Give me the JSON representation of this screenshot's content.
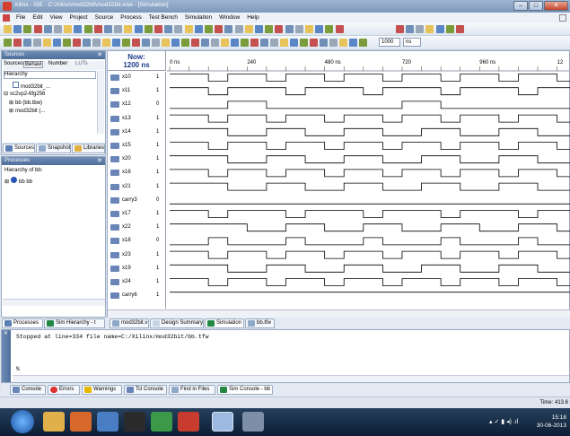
{
  "window": {
    "title": "Xilinx - ISE - C:\\Xilinx\\mod32bit\\mod32bit.xise - [Simulation]"
  },
  "menu": [
    "File",
    "Edit",
    "View",
    "Project",
    "Source",
    "Process",
    "Test Bench",
    "Simulation",
    "Window",
    "Help"
  ],
  "toolbar": {
    "run_time": "1000",
    "run_unit": "ns"
  },
  "sources_panel": {
    "header": "Sources",
    "filters": [
      "Sources",
      "Behavi",
      "Number",
      "LUTs"
    ],
    "hierarchy_label": "Hierarchy",
    "tree": [
      "mod32bit_...",
      "xc2vp2-6fg256",
      "bb (bb.tbw)",
      "mod32bit (..."
    ],
    "tabs": [
      "Sources",
      "Snapshot",
      "Libraries"
    ]
  },
  "processes_panel": {
    "header": "Processes",
    "hierarchy_label": "Hierarchy of bb:",
    "tree": [
      "bb bb"
    ],
    "tabs": [
      "Processes",
      "Sim Hierarchy - t"
    ]
  },
  "wave": {
    "cursor_label": "Now:",
    "cursor_value": "1200 ns",
    "time_ticks": [
      {
        "t": 0,
        "label": "0 ns"
      },
      {
        "t": 240,
        "label": "240"
      },
      {
        "t": 480,
        "label": "480 ns"
      },
      {
        "t": 720,
        "label": "720"
      },
      {
        "t": 960,
        "label": "960 ns"
      },
      {
        "t": 1200,
        "label": "12"
      }
    ],
    "signals": [
      {
        "name": "x10",
        "value": "1"
      },
      {
        "name": "x11",
        "value": "1"
      },
      {
        "name": "x12",
        "value": "0"
      },
      {
        "name": "x13",
        "value": "1"
      },
      {
        "name": "x14",
        "value": "1"
      },
      {
        "name": "x15",
        "value": "1"
      },
      {
        "name": "x20",
        "value": "1"
      },
      {
        "name": "x16",
        "value": "1"
      },
      {
        "name": "x21",
        "value": "1"
      },
      {
        "name": "carry3",
        "value": "0"
      },
      {
        "name": "x17",
        "value": "1"
      },
      {
        "name": "x22",
        "value": "1"
      },
      {
        "name": "x18",
        "value": "0"
      },
      {
        "name": "x23",
        "value": "1"
      },
      {
        "name": "x19",
        "value": "1"
      },
      {
        "name": "x24",
        "value": "1"
      },
      {
        "name": "carry6",
        "value": "1"
      }
    ]
  },
  "editor_tabs": [
    "mod32bit.v",
    "Design Summary",
    "Simulation",
    "bb.tfw"
  ],
  "console": {
    "line1": "Stopped at line=334 file name=C:/Xilinx/mod32bit/bb.tfw",
    "prompt": "%"
  },
  "console_tabs": [
    "Console",
    "Errors",
    "Warnings",
    "Tcl Console",
    "Find in Files",
    "Sim Console - bb"
  ],
  "status": {
    "time": "Time: 413.6"
  },
  "tray": {
    "time": "15:18",
    "date": "30-06-2013"
  },
  "colors": {
    "title_bar": "#7d98bd",
    "pane_header": "#4e6e9a",
    "wave": "#000000",
    "taskbar": "#0c1d33"
  }
}
